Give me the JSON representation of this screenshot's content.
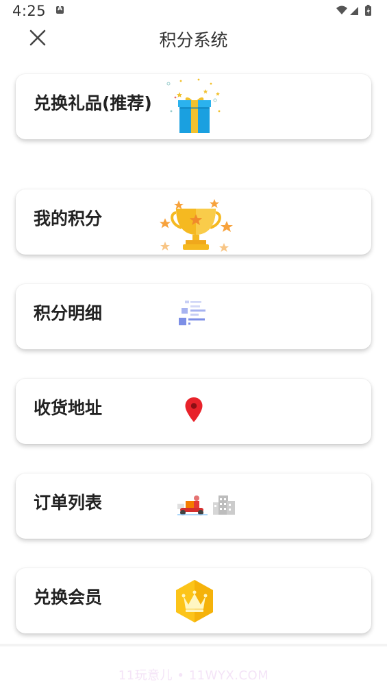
{
  "status_bar": {
    "time": "4:25"
  },
  "header": {
    "title": "积分系统"
  },
  "cards": [
    {
      "label": "兑换礼品(推荐)",
      "icon": "gift-box-icon"
    },
    {
      "label": "我的积分",
      "icon": "trophy-icon"
    },
    {
      "label": "积分明细",
      "icon": "list-detail-icon"
    },
    {
      "label": "收货地址",
      "icon": "location-pin-icon"
    },
    {
      "label": "订单列表",
      "icon": "delivery-scooter-icon"
    },
    {
      "label": "兑换会员",
      "icon": "crown-hexagon-icon"
    }
  ],
  "watermark": "11玩意儿 • 11WYX.COM",
  "colors": {
    "gift_blue": "#1aa0e0",
    "gift_ribbon": "#f2c12e",
    "trophy_gold": "#f5b921",
    "star_orange": "#f7a23c",
    "list_blue": "#7d8fe6",
    "pin_red": "#e8222a",
    "crown_yellow": "#fcc419"
  }
}
